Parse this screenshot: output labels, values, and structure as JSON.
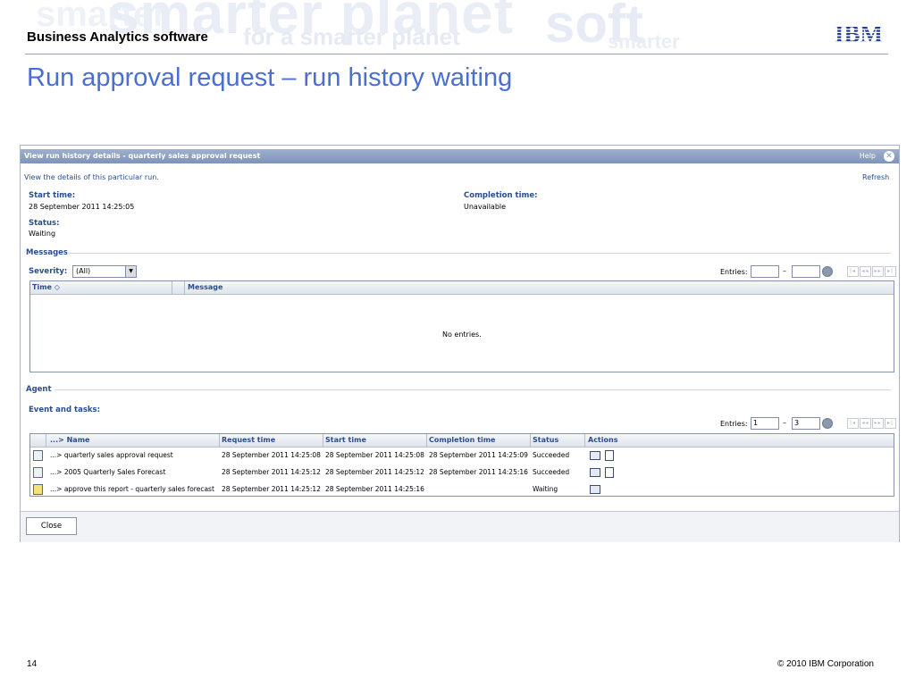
{
  "slide": {
    "section": "Business Analytics software",
    "title": "Run approval request – run history waiting",
    "page_number": "14",
    "copyright": "© 2010 IBM Corporation",
    "logo_text": "IBM",
    "watermark": [
      "smarter planet",
      "for a smarter planet",
      "soft",
      "smarter"
    ]
  },
  "dialog": {
    "title": "View run history details - quarterly sales approval request",
    "help_label": "Help",
    "description": "View the details of this particular run.",
    "refresh_label": "Refresh",
    "start_time_label": "Start time:",
    "start_time_value": "28 September 2011 14:25:05",
    "completion_time_label": "Completion time:",
    "completion_time_value": "Unavailable",
    "status_label": "Status:",
    "status_value": "Waiting",
    "messages": {
      "section_label": "Messages",
      "severity_label": "Severity:",
      "severity_value": "(All)",
      "entries_label": "Entries:",
      "entries_from": "",
      "entries_to": "",
      "columns": [
        "Time ◇",
        "Message"
      ],
      "empty_text": "No entries."
    },
    "agent_label": "Agent",
    "events": {
      "section_label": "Event and tasks:",
      "entries_label": "Entries:",
      "entries_from": "1",
      "entries_to": "3",
      "columns": [
        "...> Name",
        "Request time",
        "Start time",
        "Completion time",
        "Status",
        "Actions"
      ],
      "rows": [
        {
          "name": "...> quarterly sales approval request",
          "request_time": "28 September 2011 14:25:08",
          "start_time": "28 September 2011 14:25:08",
          "completion_time": "28 September 2011 14:25:09",
          "status": "Succeeded"
        },
        {
          "name": "...> 2005 Quarterly Sales Forecast",
          "request_time": "28 September 2011 14:25:12",
          "start_time": "28 September 2011 14:25:12",
          "completion_time": "28 September 2011 14:25:16",
          "status": "Succeeded"
        },
        {
          "name": "...> approve this report - quarterly sales forecast",
          "request_time": "28 September 2011 14:25:12",
          "start_time": "28 September 2011 14:25:16",
          "completion_time": "",
          "status": "Waiting"
        }
      ]
    },
    "close_label": "Close"
  },
  "colors": {
    "title_blue": "#4a6fd0",
    "label_blue": "#2a4d8f",
    "titlebar": "#7d93bb"
  }
}
